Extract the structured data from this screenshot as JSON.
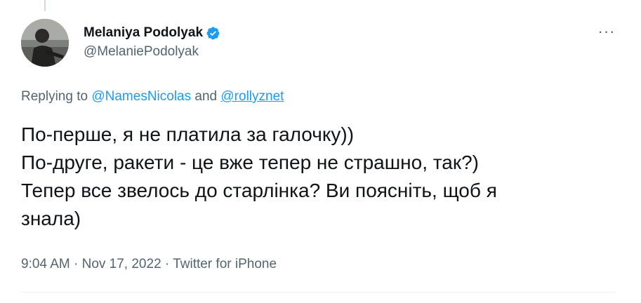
{
  "author": {
    "display_name": "Melaniya Podolyak",
    "handle": "@MelaniePodolyak",
    "verified": true,
    "verified_color": "#1d9bf0",
    "avatar_icon": "profile-photo"
  },
  "more_icon": "ellipsis-icon",
  "more_label": "···",
  "reply": {
    "prefix": "Replying to",
    "mentions": [
      "@NamesNicolas",
      "@rollyznet"
    ],
    "conjunction": "and"
  },
  "tweet": {
    "lines": [
      "По-перше, я не платила за галочку))",
      "По-друге, ракети - це вже тепер не страшно, так?)",
      "Тепер все звелось до старлінка? Ви поясніть, щоб я",
      "знала)"
    ]
  },
  "meta": {
    "time": "9:04 AM",
    "separator": "·",
    "date": "Nov 17, 2022",
    "source": "Twitter for iPhone"
  },
  "colors": {
    "text": "#0f1419",
    "secondary": "#536471",
    "link": "#1d9bf0",
    "divider": "#eff3f4"
  }
}
